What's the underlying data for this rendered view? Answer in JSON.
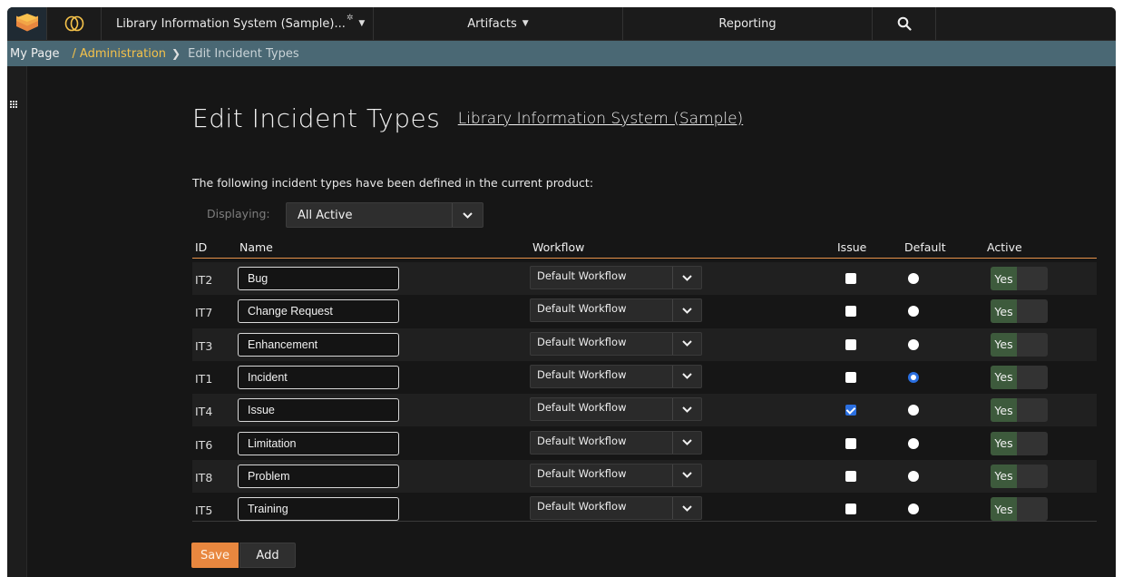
{
  "nav": {
    "product": "Library Information System (Sample)...",
    "artifacts": "Artifacts",
    "reporting": "Reporting"
  },
  "breadcrumb": {
    "my_page": "My Page",
    "separator": "/",
    "admin": "Administration",
    "current": "Edit Incident Types"
  },
  "page": {
    "title": "Edit Incident Types",
    "product_link": "Library Information System (Sample)",
    "intro": "The following incident types have been defined in the current product:",
    "displaying_label": "Displaying:",
    "displaying_value": "All Active"
  },
  "table": {
    "headers": {
      "id": "ID",
      "name": "Name",
      "workflow": "Workflow",
      "issue": "Issue",
      "default": "Default",
      "active": "Active"
    },
    "rows": [
      {
        "id": "IT2",
        "name": "Bug",
        "workflow": "Default Workflow",
        "issue": false,
        "default": false,
        "active": "Yes"
      },
      {
        "id": "IT7",
        "name": "Change Request",
        "workflow": "Default Workflow",
        "issue": false,
        "default": false,
        "active": "Yes"
      },
      {
        "id": "IT3",
        "name": "Enhancement",
        "workflow": "Default Workflow",
        "issue": false,
        "default": false,
        "active": "Yes"
      },
      {
        "id": "IT1",
        "name": "Incident",
        "workflow": "Default Workflow",
        "issue": false,
        "default": true,
        "active": "Yes"
      },
      {
        "id": "IT4",
        "name": "Issue",
        "workflow": "Default Workflow",
        "issue": true,
        "default": false,
        "active": "Yes"
      },
      {
        "id": "IT6",
        "name": "Limitation",
        "workflow": "Default Workflow",
        "issue": false,
        "default": false,
        "active": "Yes"
      },
      {
        "id": "IT8",
        "name": "Problem",
        "workflow": "Default Workflow",
        "issue": false,
        "default": false,
        "active": "Yes"
      },
      {
        "id": "IT5",
        "name": "Training",
        "workflow": "Default Workflow",
        "issue": false,
        "default": false,
        "active": "Yes"
      }
    ]
  },
  "buttons": {
    "save": "Save",
    "add": "Add"
  },
  "colors": {
    "accent_orange": "#e8873f",
    "breadcrumb_bg": "#4a6874",
    "admin_link": "#f5c24a",
    "checked_blue": "#2a6fe0",
    "active_green": "#3d5a3c"
  },
  "icons": {
    "logo": "stacked-layers-icon",
    "product": "product-rings-icon",
    "search": "search-icon",
    "rail": "grid-icon"
  }
}
